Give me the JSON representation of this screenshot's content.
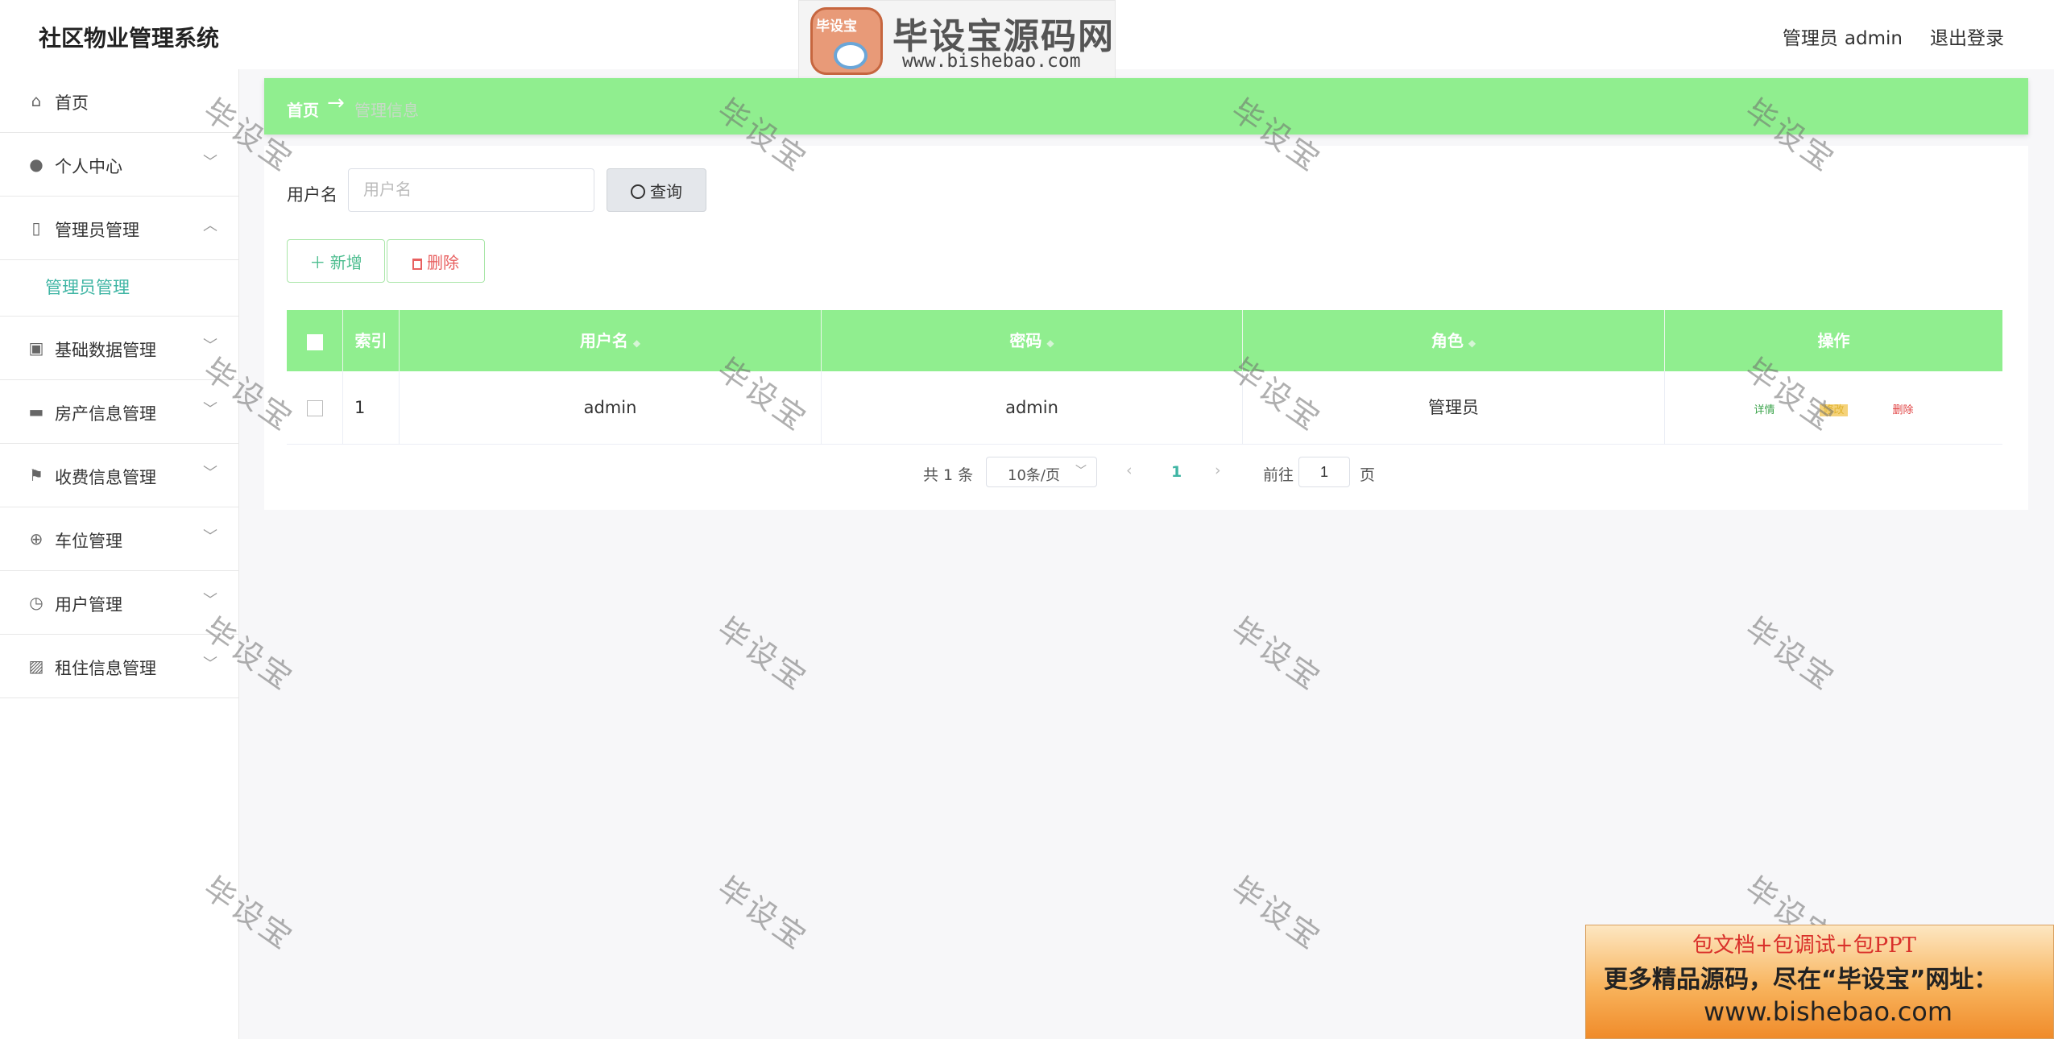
{
  "header": {
    "app_title": "社区物业管理系统",
    "user_role": "管理员",
    "user_name": "admin",
    "logout": "退出登录"
  },
  "brand": {
    "mark_text": "毕设宝",
    "name": "毕设宝源码网",
    "url": "www.bishebao.com"
  },
  "sidebar": {
    "items": [
      {
        "label": "首页",
        "icon": "home-icon"
      },
      {
        "label": "个人中心",
        "icon": "user-icon"
      },
      {
        "label": "管理员管理",
        "icon": "phone-icon"
      },
      {
        "label": "基础数据管理",
        "icon": "clipboard-icon"
      },
      {
        "label": "房产信息管理",
        "icon": "mailbox-icon"
      },
      {
        "label": "收费信息管理",
        "icon": "flag-icon"
      },
      {
        "label": "车位管理",
        "icon": "crosshair-icon"
      },
      {
        "label": "用户管理",
        "icon": "clock-icon"
      },
      {
        "label": "租住信息管理",
        "icon": "chart-icon"
      }
    ],
    "sub_item": "管理员管理"
  },
  "breadcrumb": {
    "home": "首页",
    "current": "管理信息"
  },
  "search": {
    "label": "用户名",
    "placeholder": "用户名",
    "button": "查询"
  },
  "actions": {
    "add": "新增",
    "delete": "删除"
  },
  "table": {
    "headers": [
      "索引",
      "用户名",
      "密码",
      "角色",
      "操作"
    ],
    "rows": [
      {
        "index": "1",
        "username": "admin",
        "password": "admin",
        "role": "管理员"
      }
    ],
    "row_actions": {
      "detail": "详情",
      "edit": "修改",
      "remove": "删除"
    }
  },
  "pagination": {
    "total": "共 1 条",
    "page_size": "10条/页",
    "current_page": "1",
    "goto_label": "前往",
    "goto_value": "1",
    "goto_unit": "页"
  },
  "watermark": "毕设宝",
  "promo": {
    "line1": "包文档+包调试+包PPT",
    "line2": "更多精品源码，尽在“毕设宝”网址：",
    "line3": "www.bishebao.com"
  },
  "colors": {
    "accent_green": "#90ee8f",
    "teal_text": "#3fb5a4",
    "danger_red": "#e86060"
  }
}
